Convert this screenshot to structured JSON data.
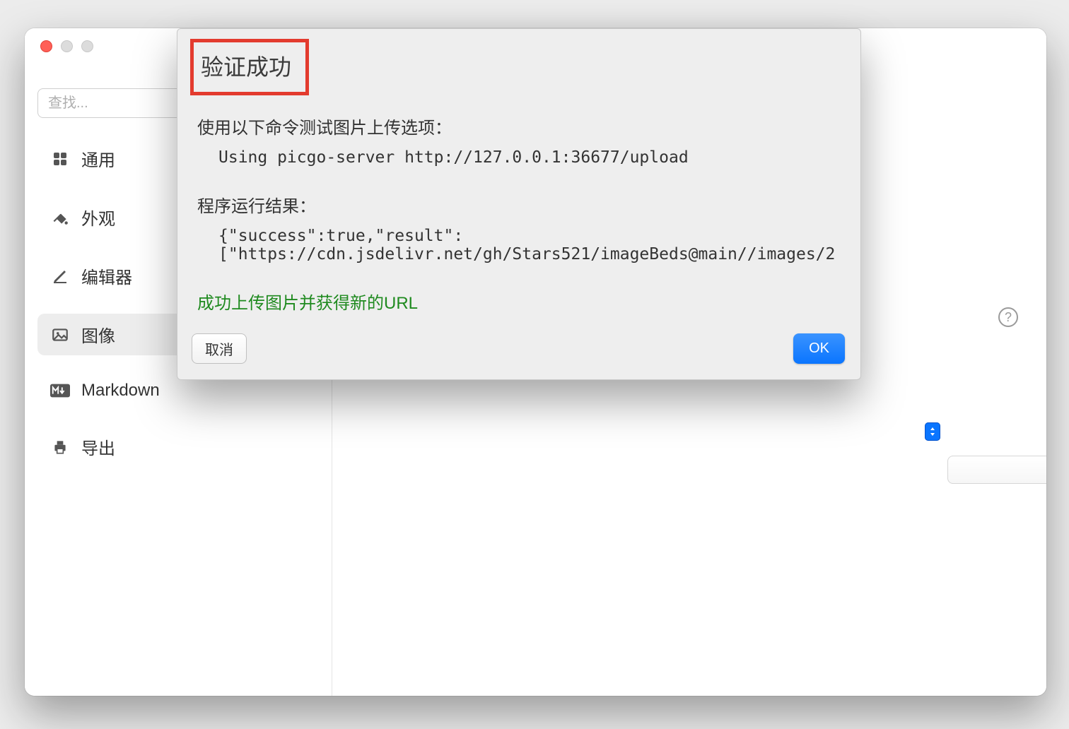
{
  "search": {
    "placeholder": "查找..."
  },
  "sidebar": {
    "items": [
      {
        "label": "通用"
      },
      {
        "label": "外观"
      },
      {
        "label": "编辑器"
      },
      {
        "label": "图像"
      },
      {
        "label": "Markdown"
      },
      {
        "label": "导出"
      }
    ]
  },
  "dialog": {
    "title": "验证成功",
    "line_test_command": "使用以下命令测试图片上传选项：",
    "command": "Using picgo-server http://127.0.0.1:36677/upload",
    "line_result": "程序运行结果：",
    "result_block": "{\"success\":true,\"result\":\n[\"https://cdn.jsdelivr.net/gh/Stars521/imageBeds@main//images/2",
    "success": "成功上传图片并获得新的URL",
    "cancel_label": "取消",
    "ok_label": "OK"
  },
  "help_glyph": "?"
}
